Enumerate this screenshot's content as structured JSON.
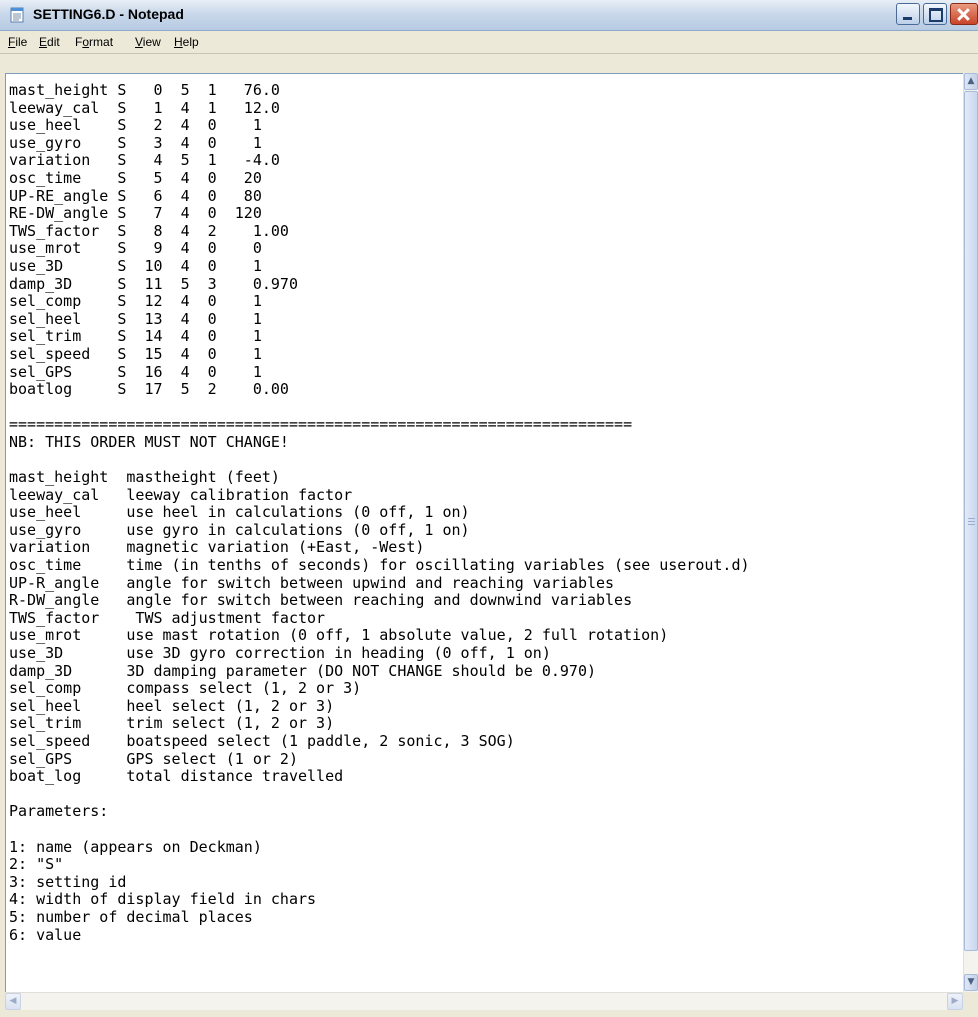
{
  "window": {
    "title": "SETTING6.D - Notepad"
  },
  "menu": {
    "items": [
      {
        "mnemonic": "F",
        "rest": "ile"
      },
      {
        "mnemonic": "E",
        "rest": "dit"
      },
      {
        "pre": "F",
        "mnemonic": "o",
        "rest": "rmat"
      },
      {
        "mnemonic": "V",
        "rest": "iew"
      },
      {
        "mnemonic": "H",
        "rest": "elp"
      }
    ]
  },
  "editor": {
    "lines": [
      "mast_height S   0  5  1   76.0",
      "leeway_cal  S   1  4  1   12.0",
      "use_heel    S   2  4  0    1",
      "use_gyro    S   3  4  0    1",
      "variation   S   4  5  1   -4.0",
      "osc_time    S   5  4  0   20",
      "UP-RE_angle S   6  4  0   80",
      "RE-DW_angle S   7  4  0  120",
      "TWS_factor  S   8  4  2    1.00",
      "use_mrot    S   9  4  0    0",
      "use_3D      S  10  4  0    1",
      "damp_3D     S  11  5  3    0.970",
      "sel_comp    S  12  4  0    1",
      "sel_heel    S  13  4  0    1",
      "sel_trim    S  14  4  0    1",
      "sel_speed   S  15  4  0    1",
      "sel_GPS     S  16  4  0    1",
      "boatlog     S  17  5  2    0.00",
      "",
      "=====================================================================",
      "NB: THIS ORDER MUST NOT CHANGE!",
      "",
      "mast_height  mastheight (feet)",
      "leeway_cal   leeway calibration factor",
      "use_heel     use heel in calculations (0 off, 1 on)",
      "use_gyro     use gyro in calculations (0 off, 1 on)",
      "variation    magnetic variation (+East, -West)",
      "osc_time     time (in tenths of seconds) for oscillating variables (see userout.d)",
      "UP-R_angle   angle for switch between upwind and reaching variables",
      "R-DW_angle   angle for switch between reaching and downwind variables",
      "TWS_factor    TWS adjustment factor",
      "use_mrot     use mast rotation (0 off, 1 absolute value, 2 full rotation)",
      "use_3D       use 3D gyro correction in heading (0 off, 1 on)",
      "damp_3D      3D damping parameter (DO NOT CHANGE should be 0.970)",
      "sel_comp     compass select (1, 2 or 3)",
      "sel_heel     heel select (1, 2 or 3)",
      "sel_trim     trim select (1, 2 or 3)",
      "sel_speed    boatspeed select (1 paddle, 2 sonic, 3 SOG)",
      "sel_GPS      GPS select (1 or 2)",
      "boat_log     total distance travelled",
      "",
      "Parameters:",
      "",
      "1: name (appears on Deckman)",
      "2: \"S\"",
      "3: setting id",
      "4: width of display field in chars",
      "5: number of decimal places",
      "6: value"
    ]
  },
  "icons": {
    "app": "notepad-icon",
    "minimize": "minimize-icon",
    "maximize": "maximize-icon",
    "close": "close-icon"
  }
}
